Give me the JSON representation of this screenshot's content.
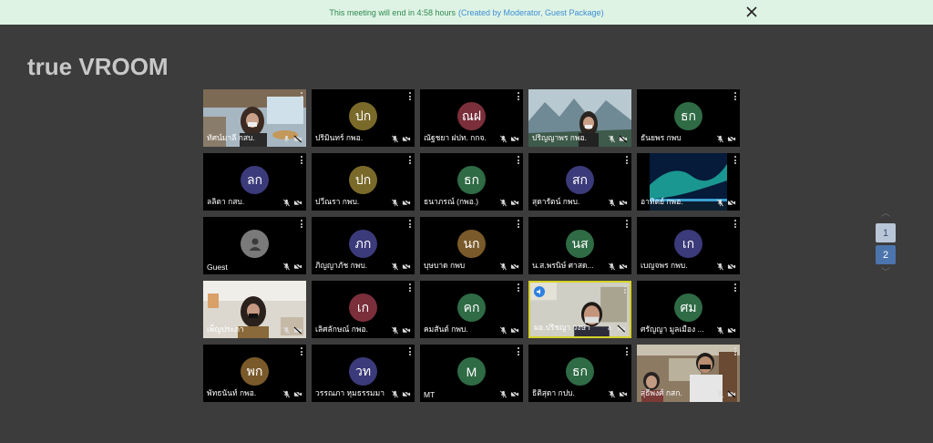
{
  "banner": {
    "message": "This meeting will end in 4:58 hours",
    "link_text": "(Created by Moderator, Guest Package)",
    "close_icon": "close-icon"
  },
  "logo": {
    "part1": "true",
    "part2": "VROOM"
  },
  "colors": {
    "active_border": "#d6d22a",
    "speaker_badge": "#2f7fe0",
    "page_current": "#4c74ad",
    "page_other": "#b9c6d8"
  },
  "participants": [
    {
      "name": "ทัศน์มาลี กสบ.",
      "avatar": "",
      "color": "",
      "photo": "woman-office-window",
      "mic": "on",
      "menu": true
    },
    {
      "name": "ปริมินทร์ กพอ.",
      "avatar": "ปก",
      "color": "#7a6a2a",
      "mic": "off",
      "menu": true
    },
    {
      "name": "ณัฐชยา ฝปท. กกจ.",
      "avatar": "ณฝ",
      "color": "#7a2f3b",
      "mic": "off",
      "menu": true
    },
    {
      "name": "ปริญญาพร กพอ.",
      "avatar": "",
      "color": "",
      "photo": "woman-mountain-bg",
      "mic": "off",
      "menu": false
    },
    {
      "name": "ธันยพร กพบ",
      "avatar": "ธก",
      "color": "#2f6b45",
      "mic": "off",
      "menu": true
    },
    {
      "name": "ลลิตา กสบ.",
      "avatar": "ลก",
      "color": "#3b3a7a",
      "mic": "off",
      "menu": true
    },
    {
      "name": "ปวีณรา กพบ.",
      "avatar": "ปก",
      "color": "#7a6a2a",
      "mic": "off",
      "menu": true
    },
    {
      "name": "ธนาภรณ์ (กพอ.)",
      "avatar": "ธก",
      "color": "#2f6b45",
      "mic": "off",
      "menu": true
    },
    {
      "name": "สุดารัตน์ กพบ.",
      "avatar": "สก",
      "color": "#3b3a7a",
      "mic": "off",
      "menu": true
    },
    {
      "name": "อาทิตย์ กพอ.",
      "avatar": "",
      "color": "",
      "photo": "aurora-bg",
      "mic": "off",
      "menu": true
    },
    {
      "name": "Guest",
      "avatar": "",
      "color": "#7a7a7a",
      "person_icon": true,
      "mic": "off",
      "menu": true
    },
    {
      "name": "ภิญญาภัช กพบ.",
      "avatar": "ภก",
      "color": "#3b3a7a",
      "mic": "off",
      "menu": true
    },
    {
      "name": "บุษบาด กพบ",
      "avatar": "นก",
      "color": "#7a5a2a",
      "mic": "off",
      "menu": true
    },
    {
      "name": "น.ส.พรนิษ์ ศาสด...",
      "avatar": "นส",
      "color": "#2f6b45",
      "mic": "off",
      "menu": true
    },
    {
      "name": "เบญจพร กพบ.",
      "avatar": "เก",
      "color": "#3b3a7a",
      "mic": "off",
      "menu": true
    },
    {
      "name": "เพ็ญประภา",
      "avatar": "",
      "color": "",
      "photo": "woman-whiteboard",
      "mic": "off",
      "menu": false
    },
    {
      "name": "เลิศลักษณ์ กพอ.",
      "avatar": "เก",
      "color": "#7a2f3b",
      "mic": "off",
      "menu": true
    },
    {
      "name": "คมสันต์ กพบ.",
      "avatar": "คก",
      "color": "#2f6b45",
      "mic": "off",
      "menu": true
    },
    {
      "name": "ผอ.ปริชญา วงษา",
      "avatar": "",
      "color": "",
      "photo": "man-office",
      "mic": "on",
      "menu": true,
      "active": true
    },
    {
      "name": "ศรัญญา มูลเมือง ...",
      "avatar": "ศม",
      "color": "#2f6b45",
      "mic": "off",
      "menu": true
    },
    {
      "name": "พัทธนันท์ กพอ.",
      "avatar": "พก",
      "color": "#7a5a2a",
      "mic": "off",
      "menu": true
    },
    {
      "name": "วรรณภา หุมธรรมมา",
      "avatar": "วท",
      "color": "#3b3a7a",
      "mic": "off",
      "menu": true
    },
    {
      "name": "MT",
      "avatar": "M",
      "color": "#2f6b45",
      "mic": "off",
      "menu": true
    },
    {
      "name": "ธิติสุดา กปบ.",
      "avatar": "ธก",
      "color": "#2f6b45",
      "mic": "off",
      "menu": true
    },
    {
      "name": "สุธีพงศ์ กสก.",
      "avatar": "",
      "color": "",
      "photo": "two-people-room",
      "mic": "off",
      "menu": true
    }
  ],
  "pager": {
    "pages": [
      "1",
      "2"
    ],
    "current": "2"
  }
}
